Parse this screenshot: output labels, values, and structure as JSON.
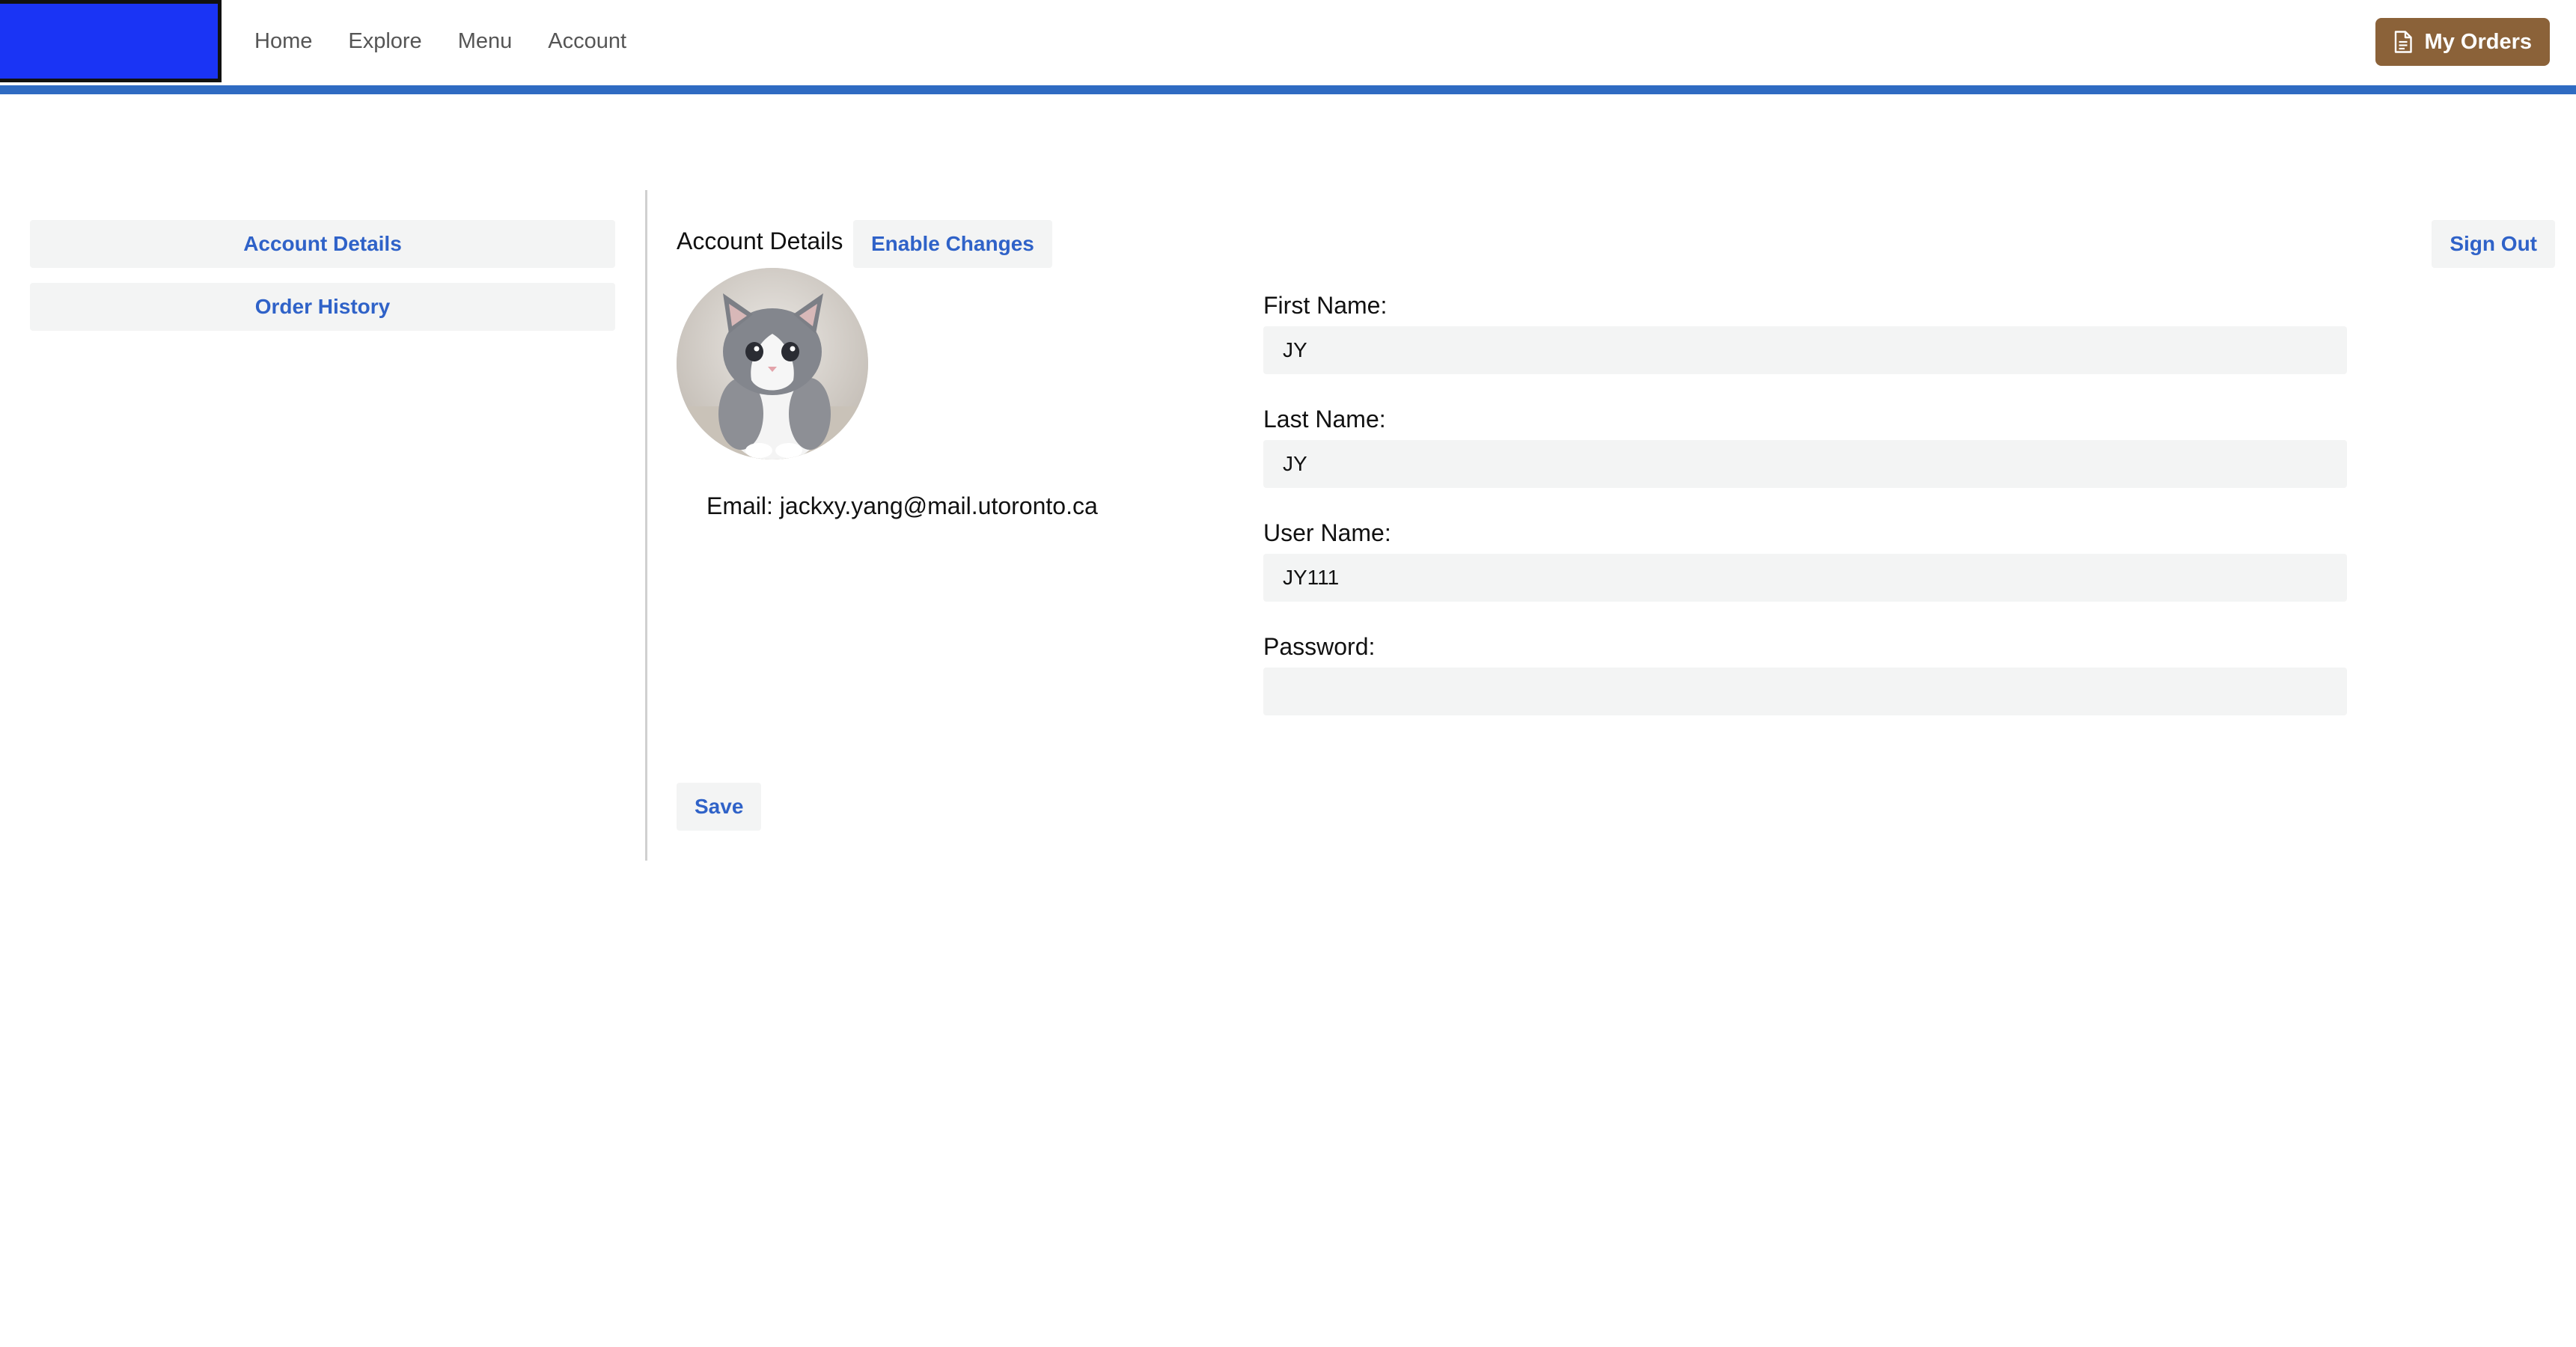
{
  "nav": {
    "links": [
      "Home",
      "Explore",
      "Menu",
      "Account"
    ],
    "orders_button": "My Orders",
    "brand_color": "#1a34f5",
    "accent_color": "#2f6bc2",
    "orders_color": "#8b6239"
  },
  "sidebar": {
    "items": [
      {
        "label": "Account Details"
      },
      {
        "label": "Order History"
      }
    ]
  },
  "main": {
    "title": "Account Details",
    "enable_button": "Enable Changes",
    "signout_button": "Sign Out",
    "avatar_icon": "cat-photo",
    "email_text": "Email: jackxy.yang@mail.utoronto.ca",
    "save_button": "Save",
    "fields": [
      {
        "label": "First Name:",
        "value": "JY"
      },
      {
        "label": "Last Name:",
        "value": "JY"
      },
      {
        "label": "User Name:",
        "value": "JY111"
      },
      {
        "label": "Password:",
        "value": ""
      }
    ]
  }
}
